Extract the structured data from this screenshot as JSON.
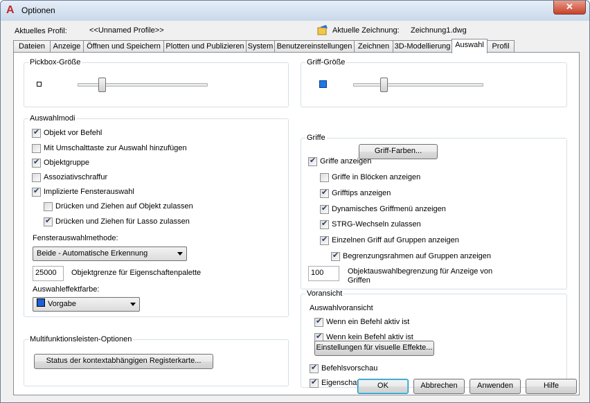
{
  "window": {
    "title": "Optionen",
    "close_symbol": "✕"
  },
  "profile": {
    "label": "Aktuelles Profil:",
    "value": "<<Unnamed Profile>>",
    "drawing_label": "Aktuelle Zeichnung:",
    "drawing_value": "Zeichnung1.dwg"
  },
  "tabs": [
    {
      "label": "Dateien"
    },
    {
      "label": "Anzeige"
    },
    {
      "label": "Öffnen und Speichern"
    },
    {
      "label": "Plotten und Publizieren"
    },
    {
      "label": "System"
    },
    {
      "label": "Benutzereinstellungen"
    },
    {
      "label": "Zeichnen"
    },
    {
      "label": "3D-Modellierung"
    },
    {
      "label": "Auswahl",
      "active": true
    },
    {
      "label": "Profil"
    }
  ],
  "pickbox": {
    "legend": "Pickbox-Größe",
    "slider_fraction": 0.17
  },
  "griff_size": {
    "legend": "Griff-Größe",
    "slider_fraction": 0.22,
    "color": "#1e78e6"
  },
  "auswahlmodi": {
    "legend": "Auswahlmodi",
    "options": [
      {
        "label": "Objekt vor Befehl",
        "checked": true
      },
      {
        "label": "Mit Umschalttaste zur Auswahl hinzufügen",
        "checked": false
      },
      {
        "label": "Objektgruppe",
        "checked": true
      },
      {
        "label": "Assoziativschraffur",
        "checked": false
      },
      {
        "label": "Implizierte Fensterauswahl",
        "checked": true
      },
      {
        "label": "Drücken und Ziehen auf Objekt zulassen",
        "checked": false
      },
      {
        "label": "Drücken und Ziehen für Lasso zulassen",
        "checked": true
      }
    ],
    "fenster_label": "Fensterauswahlmethode:",
    "fenster_value": "Beide - Automatische Erkennung",
    "objektgrenze_value": "25000",
    "objektgrenze_label": "Objektgrenze für Eigenschaftenpalette",
    "effekt_label": "Auswahleffektfarbe:",
    "effekt_value": "Vorgabe",
    "effekt_color": "#1e5fd8"
  },
  "ribbon": {
    "legend": "Multifunktionsleisten-Optionen",
    "button": "Status der kontextabhängigen Registerkarte..."
  },
  "griffe": {
    "legend": "Griffe",
    "colors_button": "Griff-Farben...",
    "options": [
      {
        "label": "Griffe anzeigen",
        "checked": true
      },
      {
        "label": "Griffe in Blöcken anzeigen",
        "checked": false
      },
      {
        "label": "Grifftips anzeigen",
        "checked": true
      },
      {
        "label": "Dynamisches Griffmenü anzeigen",
        "checked": true
      },
      {
        "label": "STRG-Wechseln zulassen",
        "checked": true
      },
      {
        "label": "Einzelnen Griff auf Gruppen anzeigen",
        "checked": true
      },
      {
        "label": "Begrenzungsrahmen auf Gruppen anzeigen",
        "checked": true
      }
    ],
    "limit_value": "100",
    "limit_label_1": "Objektauswahlbegrenzung für Anzeige von",
    "limit_label_2": "Griffen"
  },
  "voransicht": {
    "legend": "Voransicht",
    "sub": "Auswahlvoransicht",
    "options": [
      {
        "label": "Wenn ein Befehl aktiv ist",
        "checked": true
      },
      {
        "label": "Wenn kein Befehl aktiv ist",
        "checked": true
      }
    ],
    "effects_button": "Einstellungen für visuelle Effekte...",
    "options2": [
      {
        "label": "Befehlsvorschau",
        "checked": true
      },
      {
        "label": "Eigenschaftenvoransicht",
        "checked": true
      }
    ]
  },
  "footer": {
    "ok": "OK",
    "cancel": "Abbrechen",
    "apply": "Anwenden",
    "help": "Hilfe"
  }
}
